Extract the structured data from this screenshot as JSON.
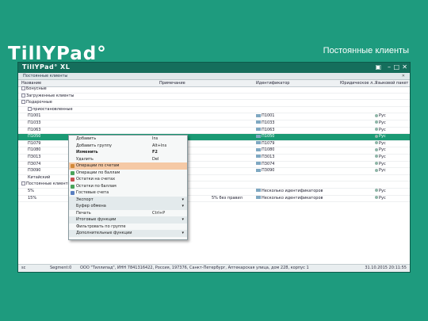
{
  "slide": {
    "logo": "TillYPad°",
    "title": "Постоянные клиенты"
  },
  "app": {
    "logo": "TillYPad° XL",
    "doc_tab": "Постоянные клиенты",
    "columns": [
      "Название",
      "Примечание",
      "Идентификатор",
      "Юридическое л...",
      "Языковой пакет"
    ],
    "rows": [
      {
        "name": "Бонусные",
        "level": 1,
        "expand": "+",
        "id": "",
        "lang": "",
        "note": ""
      },
      {
        "name": "Загруженные клиенты",
        "level": 1,
        "expand": "+",
        "id": "",
        "lang": "",
        "note": ""
      },
      {
        "name": "Подарочные",
        "level": 1,
        "expand": "-",
        "id": "",
        "lang": "",
        "note": ""
      },
      {
        "name": "приостановленные",
        "level": 2,
        "expand": "+",
        "id": "",
        "lang": "",
        "note": ""
      },
      {
        "name": "П1001",
        "level": 2,
        "expand": "",
        "id": "П1001",
        "lang": "Рус",
        "note": ""
      },
      {
        "name": "П1033",
        "level": 2,
        "expand": "",
        "id": "П1033",
        "lang": "Рус",
        "note": ""
      },
      {
        "name": "П1063",
        "level": 2,
        "expand": "",
        "id": "П1063",
        "lang": "Рус",
        "note": ""
      },
      {
        "name": "П1050",
        "level": 2,
        "expand": "",
        "id": "П1050",
        "lang": "Рус",
        "note": "",
        "selected": true
      },
      {
        "name": "П1079",
        "level": 2,
        "expand": "",
        "id": "П1079",
        "lang": "Рус",
        "note": ""
      },
      {
        "name": "П1080",
        "level": 2,
        "expand": "",
        "id": "П1080",
        "lang": "Рус",
        "note": ""
      },
      {
        "name": "П3013",
        "level": 2,
        "expand": "",
        "id": "П3013",
        "lang": "Рус",
        "note": ""
      },
      {
        "name": "П3074",
        "level": 2,
        "expand": "",
        "id": "П3074",
        "lang": "Рус",
        "note": ""
      },
      {
        "name": "П3090",
        "level": 2,
        "expand": "",
        "id": "П3090",
        "lang": "Рус",
        "note": ""
      },
      {
        "name": "Китайский",
        "level": 2,
        "expand": "",
        "id": "",
        "lang": "",
        "note": ""
      },
      {
        "name": "Постоянные клиенты",
        "level": 1,
        "expand": "-",
        "id": "",
        "lang": "",
        "note": ""
      },
      {
        "name": "5%",
        "level": 2,
        "expand": "",
        "id": "Несколько идентификаторов",
        "lang": "Рус",
        "note": ""
      },
      {
        "name": "15%",
        "level": 2,
        "expand": "",
        "id": "Несколько идентификаторов",
        "lang": "Рус",
        "note": "5% без правил"
      }
    ],
    "status": {
      "user": "sc",
      "segment": "Segment:0",
      "company": "ООО \"Тиллипад\", ИНН 7841316422, Россия, 197376, Санкт-Петербург, Аптекарская улица, дом 228, корпус 1",
      "datetime": "31.10.2015  20:11:55"
    }
  },
  "context_menu": [
    {
      "label": "Добавить",
      "shortcut": "Ins",
      "type": "item"
    },
    {
      "label": "Добавить группу",
      "shortcut": "Alt+Ins",
      "type": "item"
    },
    {
      "label": "Изменить",
      "shortcut": "F2",
      "type": "item",
      "bold": true
    },
    {
      "label": "Удалить",
      "shortcut": "Del",
      "type": "item"
    },
    {
      "label": "Операции по счетам",
      "shortcut": "",
      "type": "item",
      "highlight": true,
      "icon": "#d28a3a"
    },
    {
      "label": "Операции по баллам",
      "shortcut": "",
      "type": "item",
      "icon": "#4aa35b"
    },
    {
      "label": "Остатки на счетах",
      "shortcut": "",
      "type": "item",
      "icon": "#c85050"
    },
    {
      "label": "Остатки по баллам",
      "shortcut": "",
      "type": "item",
      "icon": "#4aa35b"
    },
    {
      "label": "Гостевые счета",
      "shortcut": "",
      "type": "item",
      "icon": "#5a7fc0"
    },
    {
      "label": "Экспорт",
      "shortcut": "",
      "type": "group"
    },
    {
      "label": "Буфер обмена",
      "shortcut": "",
      "type": "group"
    },
    {
      "label": "Печать",
      "shortcut": "Ctrl+P",
      "type": "item"
    },
    {
      "label": "Итоговые функции",
      "shortcut": "",
      "type": "group"
    },
    {
      "label": "Фильтровать по группе",
      "shortcut": "",
      "type": "item"
    },
    {
      "label": "Дополнительные функции",
      "shortcut": "",
      "type": "group"
    }
  ],
  "colors": {
    "brand": "#1e9b7e",
    "selected_row": "#1a9a74",
    "menu_highlight": "#f5c9a5"
  }
}
